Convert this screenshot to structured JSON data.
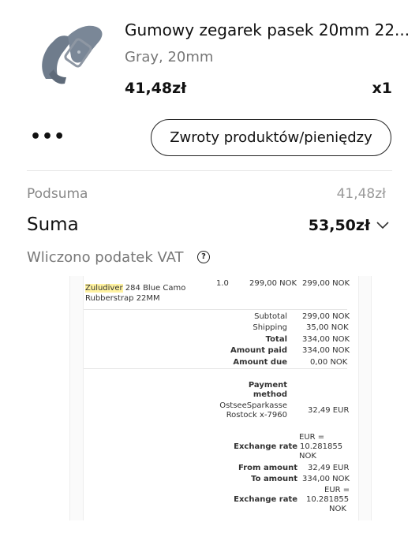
{
  "product": {
    "title": "Gumowy zegarek pasek 20mm 22...",
    "variant": "Gray, 20mm",
    "price": "41,48zł",
    "quantity": "x1",
    "image_icon": "watch-strap-image"
  },
  "actions": {
    "more_label": "•••",
    "return_label": "Zwroty produktów/pieniędzy"
  },
  "summary": {
    "subtotal_label": "Podsuma",
    "subtotal_value": "41,48zł",
    "total_label": "Suma",
    "total_value": "53,50zł",
    "vat_label": "Wliczono podatek VAT",
    "help_glyph": "?"
  },
  "receipt": {
    "item_brand": "Zuludiver",
    "item_name_rest": " 284 Blue Camo",
    "item_name_line2": "Rubberstrap 22MM",
    "item_qty": "1.0",
    "item_unit_price": "299,00 NOK",
    "item_total": "299,00 NOK",
    "subtotal_label": "Subtotal",
    "subtotal_value": "299,00 NOK",
    "shipping_label": "Shipping",
    "shipping_value": "35,00 NOK",
    "total_label": "Total",
    "total_value": "334,00 NOK",
    "amount_paid_label": "Amount paid",
    "amount_paid_value": "334,00 NOK",
    "amount_due_label": "Amount due",
    "amount_due_value": "0,00 NOK",
    "payment_method_label_1": "Payment",
    "payment_method_label_2": "method",
    "payment_bank_1": "OstseeSparkasse",
    "payment_bank_2": "Rostock x-7960",
    "payment_amount": "32,49 EUR",
    "rate1_label": "Exchange rate",
    "rate1_line1": "EUR =",
    "rate1_line2": "10.281855",
    "rate1_line3": "NOK",
    "from_amount_label": "From amount",
    "from_amount_value": "32,49 EUR",
    "to_amount_label": "To amount",
    "to_amount_value": "334,00 NOK",
    "rate2_label": "Exchange rate",
    "rate2_line1": "EUR =",
    "rate2_line2": "10.281855",
    "rate2_line3": "NOK"
  }
}
